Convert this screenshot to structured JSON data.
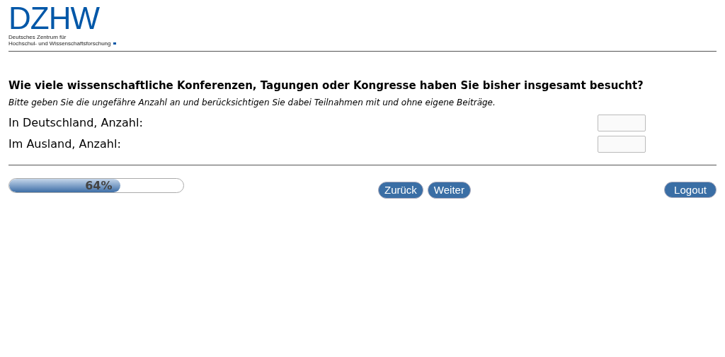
{
  "logo": {
    "wordmark": "DZHW",
    "line_1": "Deutsches Zentrum für",
    "line_2": "Hochschul- und Wissenschaftsforschung"
  },
  "question": {
    "title": "Wie viele wissenschaftliche Konferenzen, Tagungen oder Kongresse haben Sie bisher insgesamt besucht?",
    "hint": "Bitte geben Sie die ungefähre Anzahl an und berücksichtigen Sie dabei Teilnahmen mit und ohne eigene Beiträge.",
    "fields": [
      {
        "label": "In Deutschland, Anzahl:"
      },
      {
        "label": "Im Ausland, Anzahl:"
      }
    ]
  },
  "progress": {
    "level": 0.64,
    "reading": "64%"
  },
  "buttons": [
    "Zurück",
    "Weiter"
  ],
  "logout": "Logout"
}
